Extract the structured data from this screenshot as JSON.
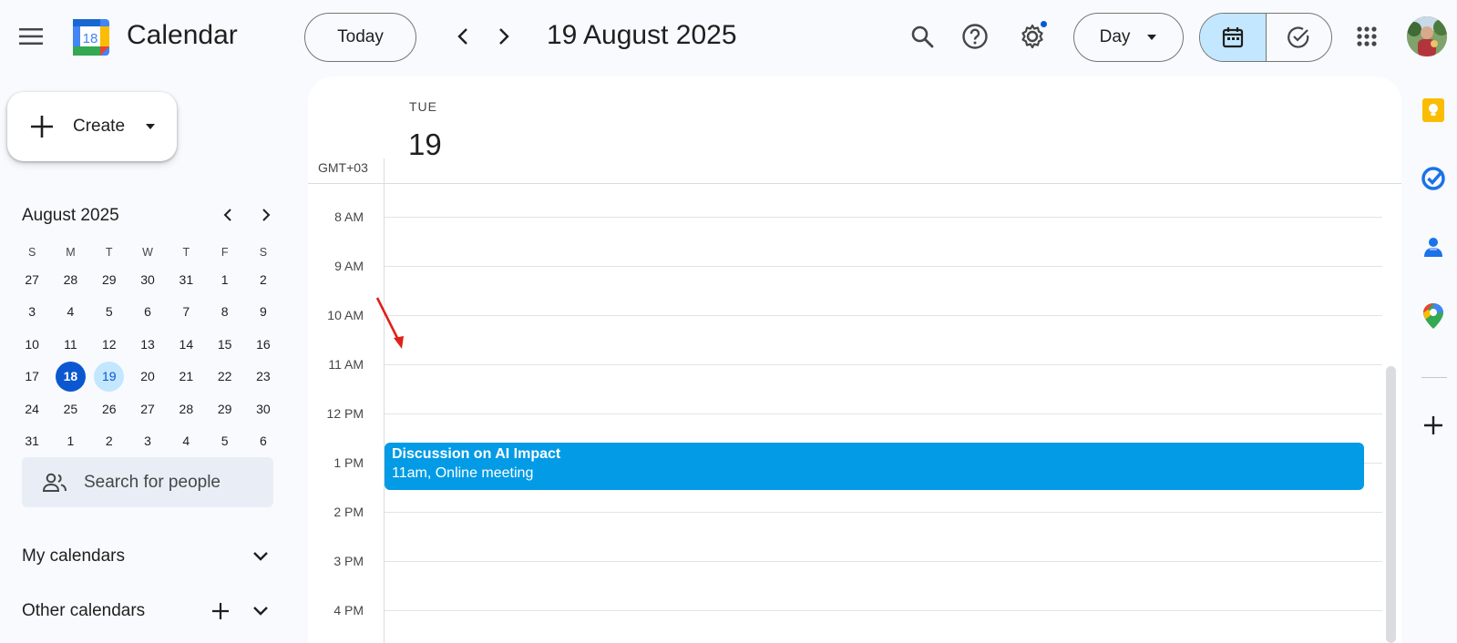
{
  "header": {
    "app_title": "Calendar",
    "logo_day": "18",
    "today_label": "Today",
    "date_title": "19 August 2025",
    "view_label": "Day"
  },
  "sidebar": {
    "create_label": "Create",
    "mini_calendar": {
      "title": "August 2025",
      "weekdays": [
        "S",
        "M",
        "T",
        "W",
        "T",
        "F",
        "S"
      ],
      "weeks": [
        [
          "27",
          "28",
          "29",
          "30",
          "31",
          "1",
          "2"
        ],
        [
          "3",
          "4",
          "5",
          "6",
          "7",
          "8",
          "9"
        ],
        [
          "10",
          "11",
          "12",
          "13",
          "14",
          "15",
          "16"
        ],
        [
          "17",
          "18",
          "19",
          "20",
          "21",
          "22",
          "23"
        ],
        [
          "24",
          "25",
          "26",
          "27",
          "28",
          "29",
          "30"
        ],
        [
          "31",
          "1",
          "2",
          "3",
          "4",
          "5",
          "6"
        ]
      ],
      "today": "18",
      "selected": "19"
    },
    "search_people_placeholder": "Search for people",
    "my_calendars_label": "My calendars",
    "other_calendars_label": "Other calendars"
  },
  "day_view": {
    "weekday": "TUE",
    "day_number": "19",
    "timezone": "GMT+03",
    "hours": [
      "8 AM",
      "9 AM",
      "10 AM",
      "11 AM",
      "12 PM",
      "1 PM",
      "2 PM",
      "3 PM",
      "4 PM"
    ],
    "event": {
      "title": "Discussion on AI Impact",
      "subtitle": "11am, Online meeting",
      "color": "#039be5"
    }
  },
  "colors": {
    "accent": "#0b57d0",
    "selected_bg": "#c2e7ff",
    "event": "#039be5"
  }
}
